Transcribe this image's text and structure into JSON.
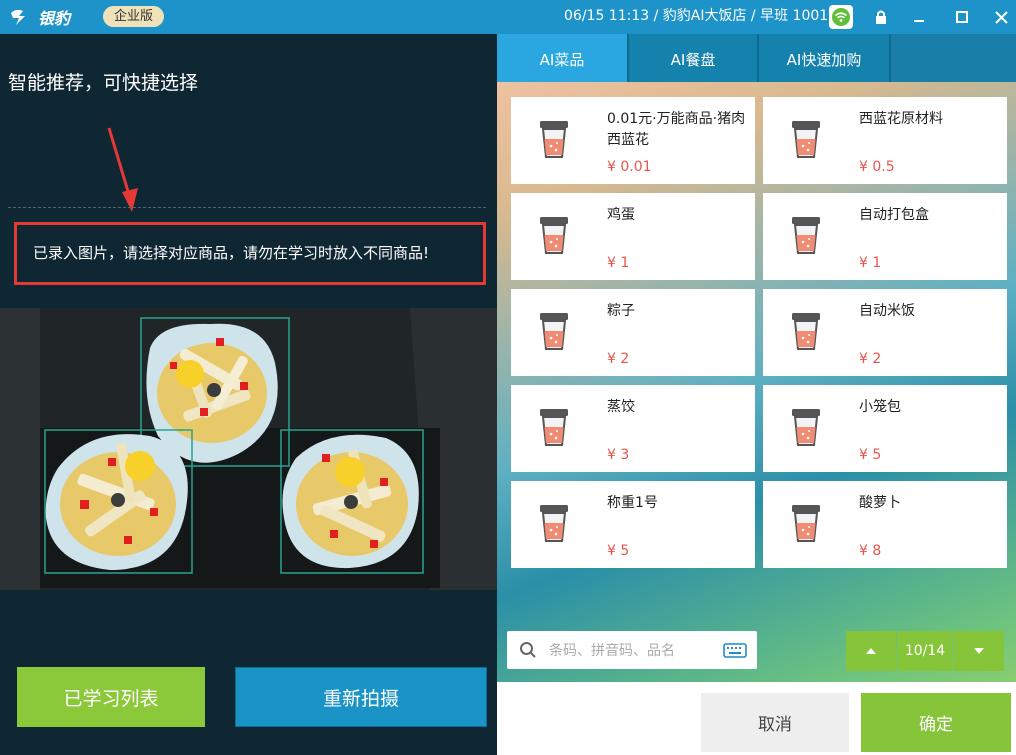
{
  "app": {
    "logo_text": "银豹",
    "edition": "企业版",
    "status_text": "06/15 11:13 / 豹豹AI大饭店 / 早班 1001"
  },
  "left": {
    "hint": "智能推荐，可快捷选择",
    "notice": "已录入图片，请选择对应商品，请勿在学习时放入不同商品!",
    "learned_button": "已学习列表",
    "retake_button": "重新拍摄"
  },
  "tabs": [
    {
      "label": "AI菜品",
      "active": true
    },
    {
      "label": "AI餐盘",
      "active": false
    },
    {
      "label": "AI快速加购",
      "active": false
    }
  ],
  "products": [
    {
      "name": "0.01元·万能商品·猪肉西蓝花",
      "price": "¥ 0.01"
    },
    {
      "name": "西蓝花原材料",
      "price": "¥ 0.5"
    },
    {
      "name": "鸡蛋",
      "price": "¥ 1"
    },
    {
      "name": "自动打包盒",
      "price": "¥ 1"
    },
    {
      "name": "粽子",
      "price": "¥ 2"
    },
    {
      "name": "自动米饭",
      "price": "¥ 2"
    },
    {
      "name": "蒸饺",
      "price": "¥ 3"
    },
    {
      "name": "小笼包",
      "price": "¥ 5"
    },
    {
      "name": "称重1号",
      "price": "¥ 5"
    },
    {
      "name": "酸萝卜",
      "price": "¥ 8"
    }
  ],
  "search": {
    "placeholder": "条码、拼音码、品名"
  },
  "pager": {
    "page": "10/14"
  },
  "footer": {
    "cancel": "取消",
    "confirm": "确定"
  },
  "colors": {
    "titlebar": "#1d93c9",
    "green": "#86c53a",
    "price": "#e8554e",
    "notice_border": "#e53935"
  }
}
